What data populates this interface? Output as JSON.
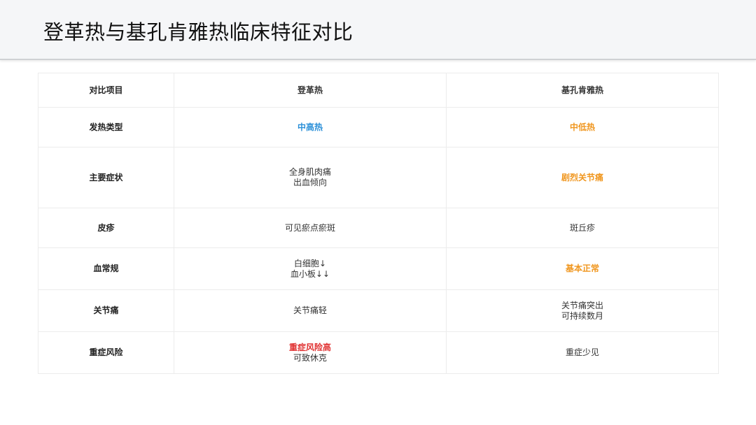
{
  "title": "登革热与基孔肯雅热临床特征对比",
  "colors": {
    "dengue_accent": "#2a8fd8",
    "chikungunya_accent": "#f0961e",
    "risk_red": "#e03131"
  },
  "table": {
    "header": {
      "label": "对比项目",
      "dengue": "登革热",
      "chikungunya": "基孔肯雅热"
    },
    "rows": [
      {
        "label": "发热类型",
        "dengue": [
          "中高热"
        ],
        "chikungunya": [
          "中低热"
        ]
      },
      {
        "label": "主要症状",
        "dengue": [
          "全身肌肉痛",
          "出血倾向"
        ],
        "chikungunya": [
          "剧烈关节痛"
        ]
      },
      {
        "label": "皮疹",
        "dengue": [
          "可见瘀点瘀斑"
        ],
        "chikungunya": [
          "斑丘疹"
        ]
      },
      {
        "label": "血常规",
        "dengue": [
          "白细胞↓",
          "血小板↓↓"
        ],
        "chikungunya": [
          "基本正常"
        ]
      },
      {
        "label": "关节痛",
        "dengue": [
          "关节痛轻"
        ],
        "chikungunya": [
          "关节痛突出",
          "可持续数月"
        ]
      },
      {
        "label": "重症风险",
        "dengue": [
          "重症风险高",
          "可致休克"
        ],
        "chikungunya": [
          "重症少见"
        ]
      }
    ]
  }
}
